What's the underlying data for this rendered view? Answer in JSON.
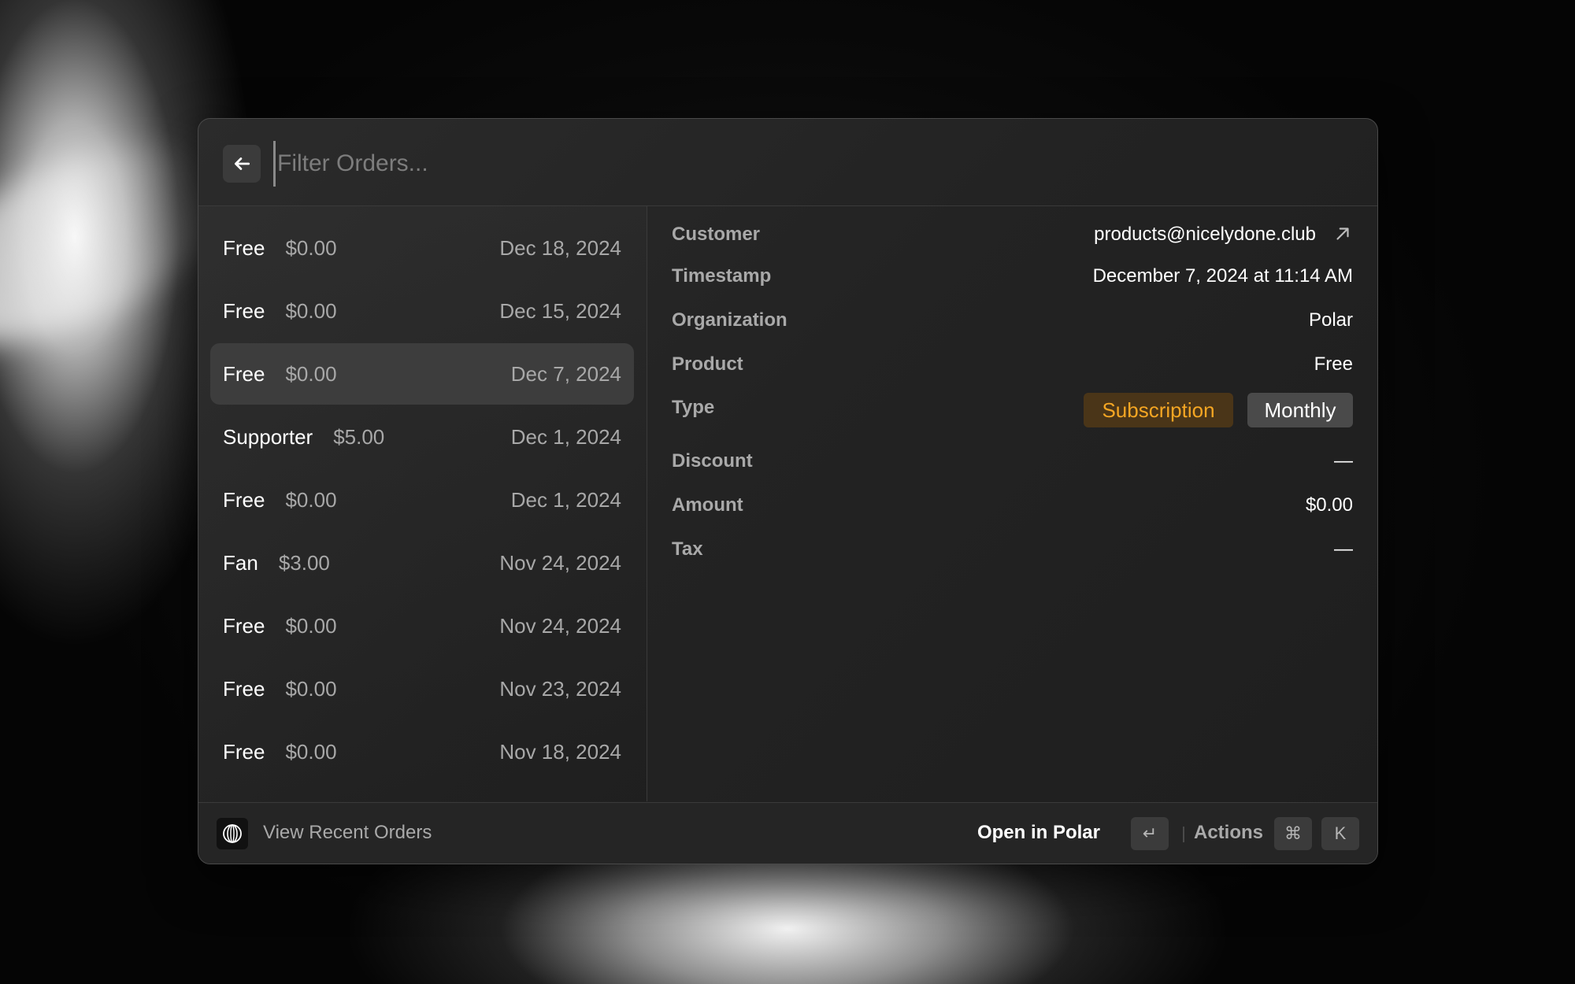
{
  "search": {
    "placeholder": "Filter Orders..."
  },
  "orders": [
    {
      "product": "Free",
      "amount": "$0.00",
      "date": "Dec 18, 2024"
    },
    {
      "product": "Free",
      "amount": "$0.00",
      "date": "Dec 15, 2024"
    },
    {
      "product": "Free",
      "amount": "$0.00",
      "date": "Dec 7, 2024",
      "selected": true
    },
    {
      "product": "Supporter",
      "amount": "$5.00",
      "date": "Dec 1, 2024"
    },
    {
      "product": "Free",
      "amount": "$0.00",
      "date": "Dec 1, 2024"
    },
    {
      "product": "Fan",
      "amount": "$3.00",
      "date": "Nov 24, 2024"
    },
    {
      "product": "Free",
      "amount": "$0.00",
      "date": "Nov 24, 2024"
    },
    {
      "product": "Free",
      "amount": "$0.00",
      "date": "Nov 23, 2024"
    },
    {
      "product": "Free",
      "amount": "$0.00",
      "date": "Nov 18, 2024"
    }
  ],
  "detail": {
    "customer_label": "Customer",
    "customer_value": "products@nicelydone.club",
    "timestamp_label": "Timestamp",
    "timestamp_value": "December 7, 2024 at 11:14 AM",
    "organization_label": "Organization",
    "organization_value": "Polar",
    "product_label": "Product",
    "product_value": "Free",
    "type_label": "Type",
    "type_tags": [
      "Subscription",
      "Monthly"
    ],
    "discount_label": "Discount",
    "discount_value": "—",
    "amount_label": "Amount",
    "amount_value": "$0.00",
    "tax_label": "Tax",
    "tax_value": "—"
  },
  "footer": {
    "title": "View Recent Orders",
    "primary_action": "Open in Polar",
    "enter_key": "↵",
    "actions_label": "Actions",
    "cmd_key": "⌘",
    "k_key": "K"
  },
  "colors": {
    "subscription_tag_text": "#f5a623",
    "subscription_tag_bg": "#4a3518",
    "selected_row_bg": "#3d3d3d"
  },
  "icons": {
    "back": "arrow-left-icon",
    "external": "arrow-up-right-icon",
    "logo": "polar-logo-icon"
  }
}
